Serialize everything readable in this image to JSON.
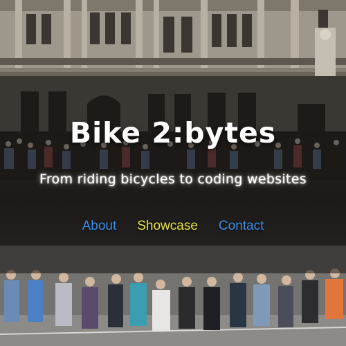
{
  "hero": {
    "title": "Bike 2:bytes",
    "tagline": "From riding bicycles to coding websites"
  },
  "nav": {
    "items": [
      {
        "label": "About",
        "state": "default"
      },
      {
        "label": "Showcase",
        "state": "active"
      },
      {
        "label": "Contact",
        "state": "default"
      }
    ]
  },
  "colors": {
    "nav_link": "#3c8ee8",
    "nav_active": "#e6e44a",
    "title": "#ffffff"
  },
  "background": {
    "image_icon": "building-crowd-photo"
  }
}
